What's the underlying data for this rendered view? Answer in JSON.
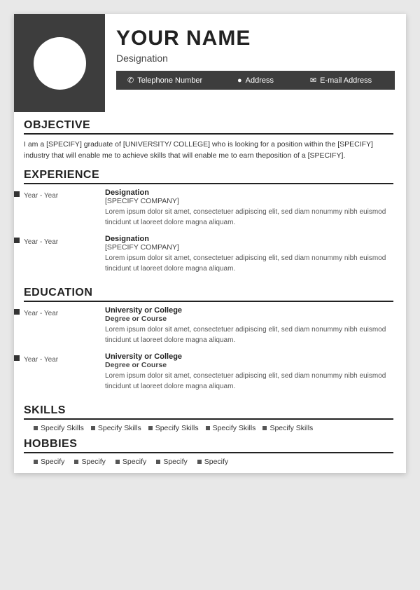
{
  "header": {
    "name": "YOUR NAME",
    "designation": "Designation",
    "contact": {
      "phone_icon": "📞",
      "phone_label": "Telephone Number",
      "address_icon": "📍",
      "address_label": "Address",
      "email_icon": "✉",
      "email_label": "E-mail Address"
    }
  },
  "objective": {
    "title": "OBJECTIVE",
    "text": "I am a [SPECIFY] graduate of [UNIVERSITY/ COLLEGE] who is looking for a position within the [SPECIFY] industry that will enable me to achieve skills that will enable me to earn theposition of a [SPECIFY]."
  },
  "experience": {
    "title": "EXPERIENCE",
    "entries": [
      {
        "years": "Year - Year",
        "title": "Designation",
        "company": "[SPECIFY COMPANY]",
        "desc": "Lorem ipsum dolor sit amet, consectetuer adipiscing elit, sed diam nonummy nibh euismod tincidunt ut laoreet dolore magna aliquam."
      },
      {
        "years": "Year - Year",
        "title": "Designation",
        "company": "[SPECIFY COMPANY]",
        "desc": "Lorem ipsum dolor sit amet, consectetuer adipiscing elit, sed diam nonummy nibh euismod tincidunt ut laoreet dolore magna aliquam."
      }
    ]
  },
  "education": {
    "title": "EDUCATION",
    "entries": [
      {
        "years": "Year - Year",
        "school": "University or College",
        "degree": "Degree or Course",
        "desc": "Lorem ipsum dolor sit amet, consectetuer adipiscing elit, sed diam nonummy nibh euismod tincidunt ut laoreet dolore magna aliquam."
      },
      {
        "years": "Year - Year",
        "school": "University or College",
        "degree": "Degree or Course",
        "desc": "Lorem ipsum dolor sit amet, consectetuer adipiscing elit, sed diam nonummy nibh euismod tincidunt ut laoreet dolore magna aliquam."
      }
    ]
  },
  "skills": {
    "title": "SKILLS",
    "items": [
      "Specify Skills",
      "Specify Skills",
      "Specify Skills",
      "Specify Skills",
      "Specify Skills"
    ]
  },
  "hobbies": {
    "title": "HOBBIES",
    "items": [
      "Specify",
      "Specify",
      "Specify",
      "Specify",
      "Specify"
    ]
  }
}
